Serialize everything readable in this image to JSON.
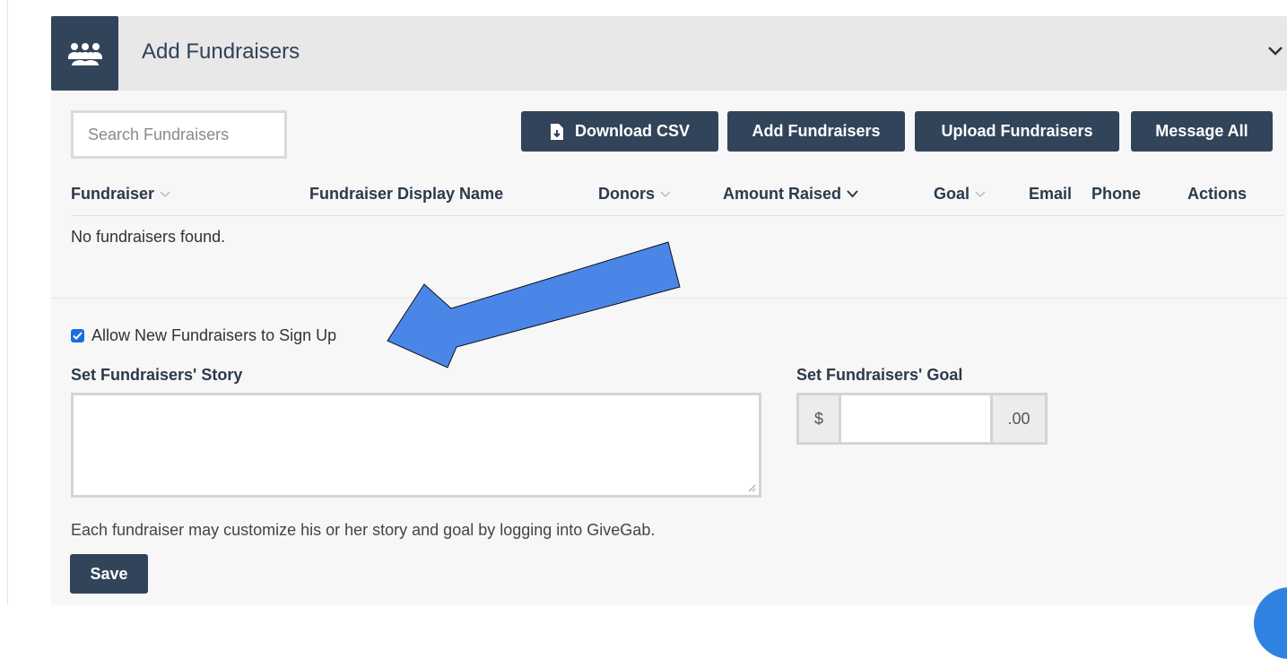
{
  "header": {
    "title": "Add Fundraisers",
    "icon": "group-icon"
  },
  "toolbar": {
    "search_placeholder": "Search Fundraisers",
    "buttons": {
      "download_csv": "Download CSV",
      "add_fundraisers": "Add Fundraisers",
      "upload_fundraisers": "Upload Fundraisers",
      "message_all": "Message All"
    }
  },
  "table": {
    "columns": {
      "fundraiser": "Fundraiser",
      "display_name": "Fundraiser Display Name",
      "donors": "Donors",
      "amount_raised": "Amount Raised",
      "goal": "Goal",
      "email": "Email",
      "phone": "Phone",
      "actions": "Actions"
    },
    "empty_message": "No fundraisers found."
  },
  "settings": {
    "allow_signup_label": "Allow New Fundraisers to Sign Up",
    "allow_signup_checked": true,
    "story_label": "Set Fundraisers' Story",
    "story_value": "",
    "goal_label": "Set Fundraisers' Goal",
    "goal_prefix": "$",
    "goal_suffix": ".00",
    "goal_value": "",
    "help_text": "Each fundraiser may customize his or her story and goal by logging into GiveGab.",
    "save_label": "Save"
  },
  "colors": {
    "primary": "#324459",
    "annotation_arrow": "#4a86e8",
    "checkbox": "#1a6fe0"
  }
}
